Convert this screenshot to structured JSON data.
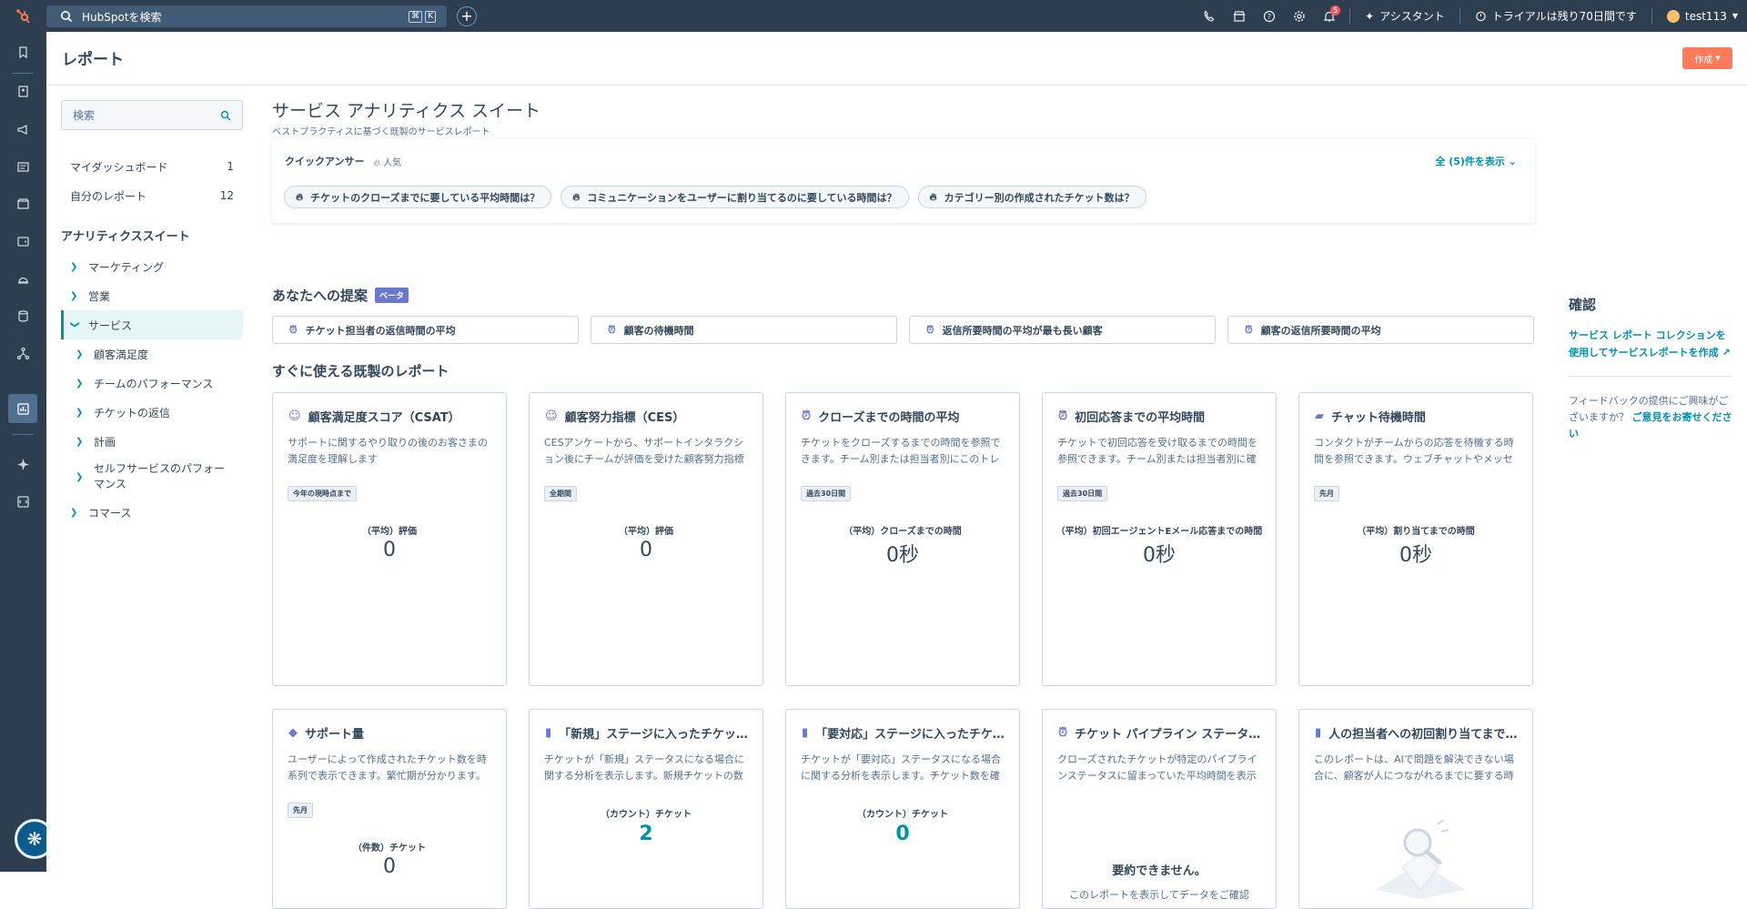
{
  "topbar": {
    "search_placeholder": "HubSpotを検索",
    "kbd1": "⌘",
    "kbd2": "K",
    "notif_count": "5",
    "assistant_label": "アシスタント",
    "trial_label": "トライアルは残り70日間です",
    "user_name": "test113"
  },
  "header": {
    "title": "レポート",
    "create_label": "作成"
  },
  "sidebar": {
    "search_placeholder": "検索",
    "my_dashboards": {
      "label": "マイダッシュボード",
      "count": "1"
    },
    "my_reports": {
      "label": "自分のレポート",
      "count": "12"
    },
    "section_title": "アナリティクススイート",
    "items": [
      {
        "label": "マーケティング"
      },
      {
        "label": "営業"
      },
      {
        "label": "サービス"
      },
      {
        "label": "顧客満足度"
      },
      {
        "label": "チームのパフォーマンス"
      },
      {
        "label": "チケットの返信"
      },
      {
        "label": "計画"
      },
      {
        "label": "セルフサービスのパフォーマンス"
      },
      {
        "label": "コマース"
      }
    ]
  },
  "main": {
    "title": "サービス アナリティクス スイート",
    "subtitle": "ベストプラクティスに基づく既製のサービスレポート",
    "quick": {
      "title": "クイックアンサー",
      "popular": "人気",
      "show_all": "全 (5)件を表示",
      "chips": [
        "チケットのクローズまでに要している平均時間は？",
        "コミュニケーションをユーザーに割り当てるのに要している時間は？",
        "カテゴリー別の作成されたチケット数は？"
      ]
    },
    "suggest": {
      "title": "あなたへの提案",
      "beta": "ベータ",
      "items": [
        "チケット担当者の返信時間の平均",
        "顧客の待機時間",
        "返信所要時間の平均が最も長い顧客",
        "顧客の返信所要時間の平均"
      ]
    },
    "ready": {
      "title": "すぐに使える既製のレポート",
      "cards": [
        {
          "title": "顧客満足度スコア（CSAT）",
          "desc": "サポートに関するやり取りの後のお客さまの満足度を理解します",
          "tag": "今年の現時点まで",
          "label": "（平均）評価",
          "value": "0"
        },
        {
          "title": "顧客努力指標（CES）",
          "desc": "CESアンケートから、サポートインタラクション後にチームが評価を受けた顧客努力指標を確認できます。",
          "tag": "全期間",
          "label": "（平均）評価",
          "value": "0"
        },
        {
          "title": "クローズまでの時間の平均",
          "desc": "チケットをクローズするまでの時間を参照できます。チーム別または担当者別にこのトレンドを確認できます。",
          "tag": "過去30日間",
          "label": "（平均）クローズまでの時間",
          "value": "0秒"
        },
        {
          "title": "初回応答までの平均時間",
          "desc": "チケットで初回応答を受け取るまでの時間を参照できます。チーム別または担当者別に確認できます。",
          "tag": "過去30日間",
          "label": "（平均）初回エージェントEメール応答までの時間",
          "value": "0秒"
        },
        {
          "title": "チャット待機時間",
          "desc": "コンタクトがチームからの応答を待機する時間を参照できます。ウェブチャットやメッセンジャーで確認できます。",
          "tag": "先月",
          "label": "（平均）割り当てまでの時間",
          "value": "0秒"
        },
        {
          "title": "サポート量",
          "desc": "ユーザーによって作成されたチケット数を時系列で表示できます。繁忙期が分かります。",
          "tag": "先月",
          "label": "（件数）チケット",
          "value": "0"
        },
        {
          "title": "「新規」ステージに入ったチケット数",
          "desc": "チケットが「新規」ステータスになる場合に関する分析を表示します。新規チケットの数を確認できます。",
          "label": "（カウント）チケット",
          "value": "2"
        },
        {
          "title": "「要対応」ステージに入ったチケット数",
          "desc": "チケットが「要対応」ステータスになる場合に関する分析を表示します。チケット数を確認できます。",
          "label": "（カウント）チケット",
          "value": "0"
        },
        {
          "title": "チケット パイプライン ステータス時間",
          "desc": "クローズされたチケットが特定のパイプラインステータスに留まっていた平均時間を表示します。",
          "empty_title": "要約できません。",
          "empty_desc": "このレポートを表示してデータをご確認"
        },
        {
          "title": "人の担当者への初回割り当てまでの時間",
          "desc": "このレポートは、AIで問題を解決できない場合に、顧客が人につながれるまでに要する時間を表示します。"
        }
      ]
    }
  },
  "aside": {
    "title": "確認",
    "link": "サービス レポート コレクションを使用してサービスレポートを作成",
    "feedback_text": "フィードバックの提供にご興味がございますか？",
    "feedback_link": "ご意見をお寄せください"
  },
  "colors": {
    "accent": "#0091ae",
    "brand": "#ff7a59",
    "nav": "#2d3e50"
  }
}
